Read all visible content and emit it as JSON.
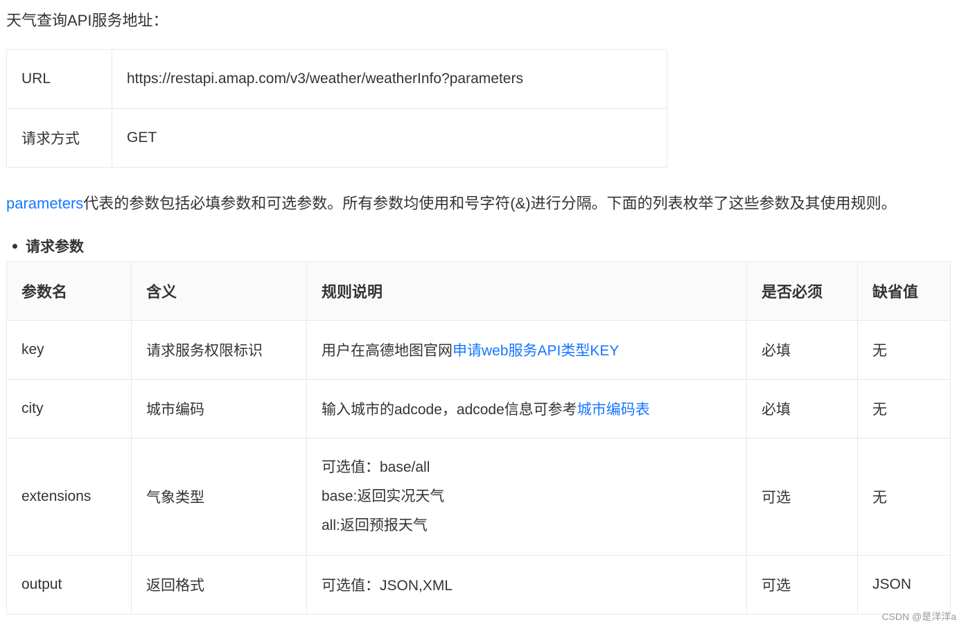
{
  "heading": "天气查询API服务地址：",
  "url_table": {
    "rows": [
      {
        "label": "URL",
        "value": "https://restapi.amap.com/v3/weather/weatherInfo?parameters"
      },
      {
        "label": "请求方式",
        "value": "GET"
      }
    ]
  },
  "intro": {
    "link_text": "parameters",
    "text": "代表的参数包括必填参数和可选参数。所有参数均使用和号字符(&)进行分隔。下面的列表枚举了这些参数及其使用规则。"
  },
  "section_title": "请求参数",
  "param_table": {
    "headers": [
      "参数名",
      "含义",
      "规则说明",
      "是否必须",
      "缺省值"
    ],
    "rows": [
      {
        "name": "key",
        "meaning": "请求服务权限标识",
        "rule_text": "用户在高德地图官网",
        "rule_link": "申请web服务API类型KEY",
        "required": "必填",
        "default": "无"
      },
      {
        "name": "city",
        "meaning": "城市编码",
        "rule_text": "输入城市的adcode，adcode信息可参考",
        "rule_link": "城市编码表",
        "required": "必填",
        "default": "无"
      },
      {
        "name": "extensions",
        "meaning": "气象类型",
        "rule_lines": [
          "可选值：base/all",
          "base:返回实况天气",
          "all:返回预报天气"
        ],
        "required": "可选",
        "default": "无"
      },
      {
        "name": "output",
        "meaning": "返回格式",
        "rule_text": "可选值：JSON,XML",
        "required": "可选",
        "default": "JSON"
      }
    ]
  },
  "watermark": "CSDN @是洋洋a",
  "colors": {
    "link": "#1677ff",
    "text": "#333333",
    "border": "#e8e8e8",
    "header_bg": "#fafafa"
  }
}
